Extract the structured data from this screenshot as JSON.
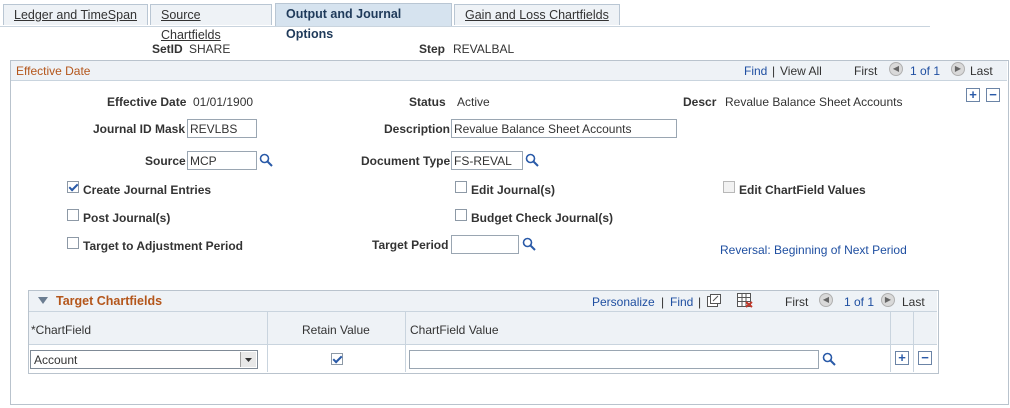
{
  "tabs": [
    {
      "label": "Ledger and TimeSpan"
    },
    {
      "label": "Source Chartfields"
    },
    {
      "label": "Output and Journal Options"
    },
    {
      "label": "Gain and Loss Chartfields"
    }
  ],
  "header": {
    "setid_label": "SetID",
    "setid_value": "SHARE",
    "step_label": "Step",
    "step_value": "REVALBAL"
  },
  "effdate_section": {
    "title": "Effective Date",
    "find": "Find",
    "separator": "|",
    "view_all": "View All",
    "first": "First",
    "count": "1 of 1",
    "last": "Last",
    "prev_icon": "arrow-left-icon",
    "next_icon": "arrow-right-icon"
  },
  "form": {
    "effdate_label": "Effective Date",
    "effdate_value": "01/01/1900",
    "status_label": "Status",
    "status_value": "Active",
    "descr_label": "Descr",
    "descr_value": "Revalue Balance Sheet Accounts",
    "journal_mask_label": "Journal ID Mask",
    "journal_mask_value": "REVLBS",
    "description_label": "Description",
    "description_value": "Revalue Balance Sheet Accounts",
    "source_label": "Source",
    "source_value": "MCP",
    "doctype_label": "Document Type",
    "doctype_value": "FS-REVAL",
    "create_journal_label": "Create Journal Entries",
    "create_journal_checked": true,
    "edit_journal_label": "Edit Journal(s)",
    "edit_journal_checked": false,
    "edit_chartfield_label": "Edit ChartField Values",
    "edit_chartfield_checked": false,
    "post_journal_label": "Post Journal(s)",
    "post_journal_checked": false,
    "budget_check_label": "Budget Check Journal(s)",
    "budget_check_checked": false,
    "target_adj_label": "Target to Adjustment Period",
    "target_adj_checked": false,
    "target_period_label": "Target Period",
    "target_period_value": "",
    "reversal_link": "Reversal: Beginning of Next Period"
  },
  "target_chartfields": {
    "title": "Target Chartfields",
    "personalize": "Personalize",
    "separator": "|",
    "find": "Find",
    "first": "First",
    "count": "1 of 1",
    "last": "Last",
    "columns": [
      "*ChartField",
      "Retain Value",
      "ChartField Value"
    ],
    "rows": [
      {
        "chartfield": "Account",
        "retain_value": true,
        "chartfield_value": ""
      }
    ]
  },
  "colors": {
    "accent": "#b4561b",
    "link": "#1f4fa1",
    "tab_active_bg": "#d6e3ef",
    "header_bg": "#eef2f6"
  }
}
